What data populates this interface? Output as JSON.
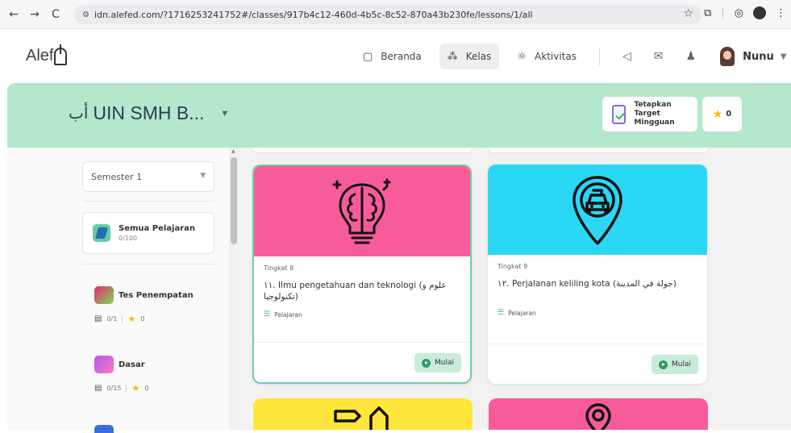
{
  "browser": {
    "url": "idn.alefed.com/?1716253241752#/classes/917b4c12-460d-4b5c-8c52-870a43b230fe/lessons/1/all",
    "back": "←",
    "forward": "→",
    "reload": "C"
  },
  "header": {
    "logo_text": "Alef",
    "nav": [
      {
        "label": "Beranda",
        "icon": "book-icon"
      },
      {
        "label": "Kelas",
        "icon": "class-icon"
      },
      {
        "label": "Aktivitas",
        "icon": "activity-icon"
      }
    ],
    "username": "Nunu"
  },
  "class_bar": {
    "arabic_prefix": "أب",
    "class_name": "UIN SMH B...",
    "weekly_target_label": "Tetapkan Target\nMingguan",
    "stars": "0"
  },
  "sidebar": {
    "semester": "Semester 1",
    "all_lessons": {
      "title": "Semua Pelajaran",
      "progress": "0/100"
    },
    "levels": [
      {
        "name": "Tes Penempatan",
        "progress": "0/1",
        "stars": "0",
        "badge_color": "#e9246f"
      },
      {
        "name": "Dasar",
        "progress": "0/15",
        "stars": "0",
        "badge_color": "#b05be8"
      }
    ]
  },
  "lessons": [
    {
      "level": "Tingkat 8",
      "title": "١١. Ilmu pengetahuan dan teknologi (علوم و تكنولوجيا)",
      "type": "Pelajaran",
      "button": "Mulai",
      "color": "#f85b9a",
      "icon": "brain-lightbulb-icon"
    },
    {
      "level": "Tingkat 9",
      "title": "١٢. Perjalanan keliling kota (جولة في المدينة)",
      "type": "Pelajaran",
      "button": "Mulai",
      "color": "#2ad7f5",
      "icon": "taxi-location-icon"
    }
  ],
  "next_cards": [
    {
      "color": "#ffe53c",
      "icon": "tag-house-icon"
    },
    {
      "color": "#f85b9a",
      "icon": "gear-location-icon"
    }
  ]
}
